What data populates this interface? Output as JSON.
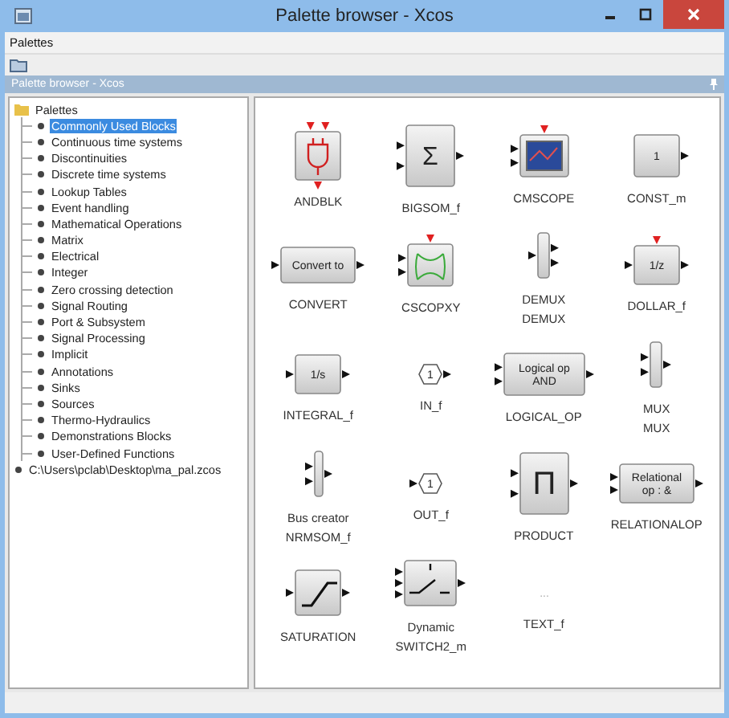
{
  "window": {
    "title": "Palette browser - Xcos"
  },
  "menu": [
    "Palettes"
  ],
  "dock": {
    "title": "Palette browser - Xcos"
  },
  "tree": [
    {
      "label": "Palettes",
      "kind": "folder",
      "selected": false,
      "expanded": true,
      "children": [
        {
          "label": "Commonly Used Blocks",
          "selected": true
        },
        {
          "label": "Continuous time systems",
          "selected": false
        },
        {
          "label": "Discontinuities",
          "selected": false
        },
        {
          "label": "Discrete time systems",
          "selected": false
        },
        {
          "label": "Lookup Tables",
          "selected": false
        },
        {
          "label": "Event handling",
          "selected": false
        },
        {
          "label": "Mathematical Operations",
          "selected": false
        },
        {
          "label": "Matrix",
          "selected": false
        },
        {
          "label": "Electrical",
          "selected": false
        },
        {
          "label": "Integer",
          "selected": false
        },
        {
          "label": "Zero crossing detection",
          "selected": false
        },
        {
          "label": "Signal Routing",
          "selected": false
        },
        {
          "label": "Port & Subsystem",
          "selected": false
        },
        {
          "label": "Signal Processing",
          "selected": false
        },
        {
          "label": "Implicit",
          "selected": false
        },
        {
          "label": "Annotations",
          "selected": false
        },
        {
          "label": "Sinks",
          "selected": false
        },
        {
          "label": "Sources",
          "selected": false
        },
        {
          "label": "Thermo-Hydraulics",
          "selected": false
        },
        {
          "label": "Demonstrations Blocks",
          "selected": false
        },
        {
          "label": "User-Defined Functions",
          "selected": false
        }
      ]
    },
    {
      "label": "C:\\Users\\pclab\\Desktop\\ma_pal.zcos",
      "kind": "file",
      "selected": false
    }
  ],
  "blocks": [
    {
      "name": "ANDBLK",
      "kind": "and"
    },
    {
      "name": "BIGSOM_f",
      "kind": "sum",
      "inner": [
        "Σ"
      ]
    },
    {
      "name": "CMSCOPE",
      "kind": "scope"
    },
    {
      "name": "CONST_m",
      "kind": "const",
      "inner": [
        "1"
      ]
    },
    {
      "name": "CONVERT",
      "kind": "convert",
      "inner": [
        "Convert to"
      ]
    },
    {
      "name": "CSCOPXY",
      "kind": "scopexy"
    },
    {
      "name": "DEMUX",
      "kind": "demux",
      "sublabel": "DEMUX"
    },
    {
      "name": "DOLLAR_f",
      "kind": "dollar",
      "inner": [
        "1/z"
      ]
    },
    {
      "name": "INTEGRAL_f",
      "kind": "integral",
      "inner": [
        "1/s"
      ]
    },
    {
      "name": "IN_f",
      "kind": "in",
      "inner": [
        "1"
      ]
    },
    {
      "name": "LOGICAL_OP",
      "kind": "logical",
      "inner": [
        "Logical op",
        "AND"
      ]
    },
    {
      "name": "MUX",
      "kind": "mux",
      "sublabel": "MUX"
    },
    {
      "name": "NRMSOM_f",
      "kind": "buscreator",
      "sublabel": "Bus creator"
    },
    {
      "name": "OUT_f",
      "kind": "out",
      "inner": [
        "1"
      ]
    },
    {
      "name": "PRODUCT",
      "kind": "product",
      "inner": [
        "Π"
      ]
    },
    {
      "name": "RELATIONALOP",
      "kind": "relational",
      "inner": [
        "Relational",
        "op : &"
      ]
    },
    {
      "name": "SATURATION",
      "kind": "saturation"
    },
    {
      "name": "SWITCH2_m",
      "kind": "switch",
      "sublabel": "Dynamic"
    },
    {
      "name": "TEXT_f",
      "kind": "text",
      "inner": [
        "..."
      ]
    }
  ]
}
